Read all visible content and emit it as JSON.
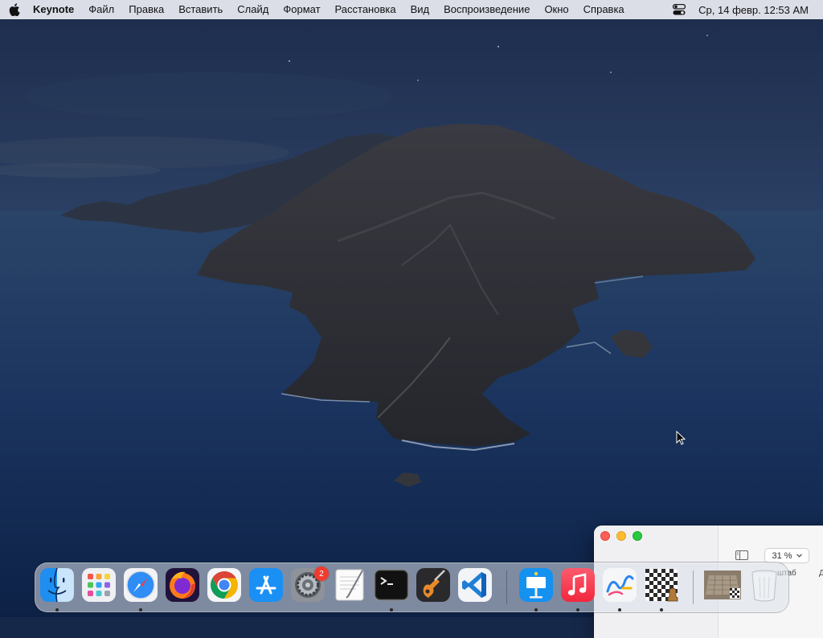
{
  "menubar": {
    "app_name": "Keynote",
    "items": [
      "Файл",
      "Правка",
      "Вставить",
      "Слайд",
      "Формат",
      "Расстановка",
      "Вид",
      "Воспроизведение",
      "Окно",
      "Справка"
    ],
    "clock": "Ср, 14 февр.  12:53 AM",
    "icons": [
      "apple-logo-icon",
      "control-center-icon"
    ]
  },
  "keynote_window": {
    "zoom_value": "31 %",
    "zoom_label": "штаб",
    "trailing_letter": "Д"
  },
  "dock": {
    "apps": [
      {
        "name": "Finder",
        "icon": "finder-icon",
        "running": true
      },
      {
        "name": "Launchpad",
        "icon": "launchpad-icon",
        "running": false
      },
      {
        "name": "Safari",
        "icon": "safari-icon",
        "running": true
      },
      {
        "name": "Firefox",
        "icon": "firefox-icon",
        "running": false
      },
      {
        "name": "Google Chrome",
        "icon": "chrome-icon",
        "running": false
      },
      {
        "name": "App Store",
        "icon": "app-store-icon",
        "running": false
      },
      {
        "name": "System Preferences",
        "icon": "system-preferences-icon",
        "running": false,
        "badge": "2"
      },
      {
        "name": "TextEdit",
        "icon": "textedit-icon",
        "running": false
      },
      {
        "name": "Terminal",
        "icon": "terminal-icon",
        "running": true
      },
      {
        "name": "GarageBand",
        "icon": "garageband-icon",
        "running": false
      },
      {
        "name": "Visual Studio Code",
        "icon": "vscode-icon",
        "running": false
      },
      {
        "name": "Keynote",
        "icon": "keynote-icon",
        "running": true
      },
      {
        "name": "Music",
        "icon": "music-icon",
        "running": true
      },
      {
        "name": "Freeform",
        "icon": "freeform-icon",
        "running": true
      },
      {
        "name": "Chess",
        "icon": "chess-icon",
        "running": true
      },
      {
        "name": "Chess window",
        "icon": "chess-window-thumbnail-icon",
        "running": false
      },
      {
        "name": "Trash",
        "icon": "trash-icon",
        "running": false
      }
    ]
  }
}
